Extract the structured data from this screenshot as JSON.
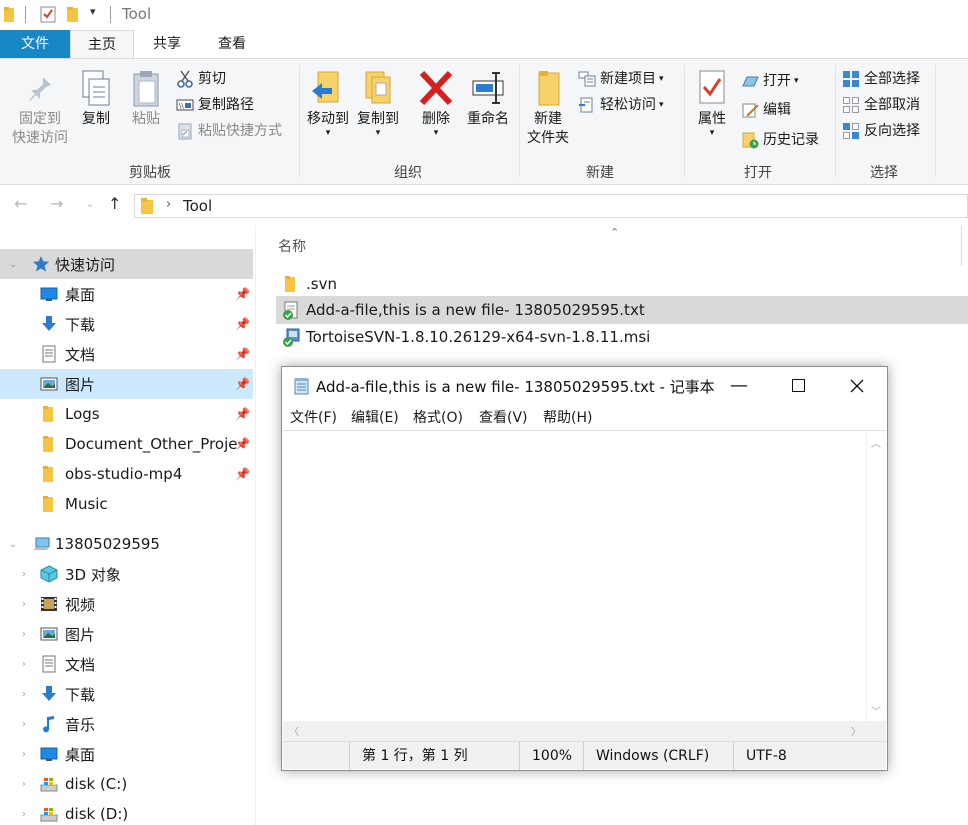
{
  "window": {
    "title": "Tool"
  },
  "ribbon_tabs": {
    "file": "文件",
    "home": "主页",
    "share": "共享",
    "view": "查看"
  },
  "clipboard": {
    "pin_line1": "固定到",
    "pin_line2": "快速访问",
    "copy": "复制",
    "paste": "粘贴",
    "cut": "剪切",
    "copy_path": "复制路径",
    "paste_shortcut": "粘贴快捷方式",
    "group_label": "剪贴板"
  },
  "organize": {
    "move_to": "移动到",
    "copy_to": "复制到",
    "delete": "删除",
    "rename": "重命名",
    "group_label": "组织"
  },
  "new": {
    "new_folder_line1": "新建",
    "new_folder_line2": "文件夹",
    "new_item": "新建项目",
    "easy_access": "轻松访问",
    "group_label": "新建"
  },
  "open": {
    "properties": "属性",
    "open": "打开",
    "edit": "编辑",
    "history": "历史记录",
    "group_label": "打开"
  },
  "select": {
    "select_all": "全部选择",
    "select_none": "全部取消",
    "invert": "反向选择",
    "group_label": "选择"
  },
  "address": {
    "path": "Tool"
  },
  "nav": {
    "quick_access": "快速访问",
    "items": [
      {
        "label": "桌面",
        "icon": "desktop-icon",
        "pinned": true
      },
      {
        "label": "下载",
        "icon": "download-icon",
        "pinned": true
      },
      {
        "label": "文档",
        "icon": "document-icon",
        "pinned": true
      },
      {
        "label": "图片",
        "icon": "picture-icon",
        "pinned": true
      },
      {
        "label": "Logs",
        "icon": "folder-icon",
        "pinned": true
      },
      {
        "label": "Document_Other_Proje",
        "icon": "folder-icon",
        "pinned": true
      },
      {
        "label": "obs-studio-mp4",
        "icon": "folder-icon",
        "pinned": true
      },
      {
        "label": "Music",
        "icon": "folder-icon",
        "pinned": false
      }
    ],
    "this_pc": "13805029595",
    "pc_items": [
      {
        "label": "3D 对象",
        "icon": "3d-objects-icon"
      },
      {
        "label": "视频",
        "icon": "video-icon"
      },
      {
        "label": "图片",
        "icon": "picture-icon"
      },
      {
        "label": "文档",
        "icon": "document-icon"
      },
      {
        "label": "下载",
        "icon": "download-icon"
      },
      {
        "label": "音乐",
        "icon": "music-icon"
      },
      {
        "label": "桌面",
        "icon": "desktop-icon"
      },
      {
        "label": "disk (C:)",
        "icon": "drive-icon"
      },
      {
        "label": "disk (D:)",
        "icon": "drive-icon"
      }
    ]
  },
  "content": {
    "column_name": "名称",
    "files": [
      {
        "name": ".svn",
        "icon": "folder-icon"
      },
      {
        "name": "Add-a-file,this is a new file- 13805029595.txt",
        "icon": "svn-text-file-icon"
      },
      {
        "name": "TortoiseSVN-1.8.10.26129-x64-svn-1.8.11.msi",
        "icon": "svn-installer-icon"
      }
    ]
  },
  "notepad": {
    "title": "Add-a-file,this is a new file- 13805029595.txt - 记事本",
    "menu": [
      "文件(F)",
      "编辑(E)",
      "格式(O)",
      "查看(V)",
      "帮助(H)"
    ],
    "content": "",
    "status": {
      "position": "第 1 行，第 1 列",
      "zoom": "100%",
      "line_ending": "Windows (CRLF)",
      "encoding": "UTF-8"
    }
  }
}
